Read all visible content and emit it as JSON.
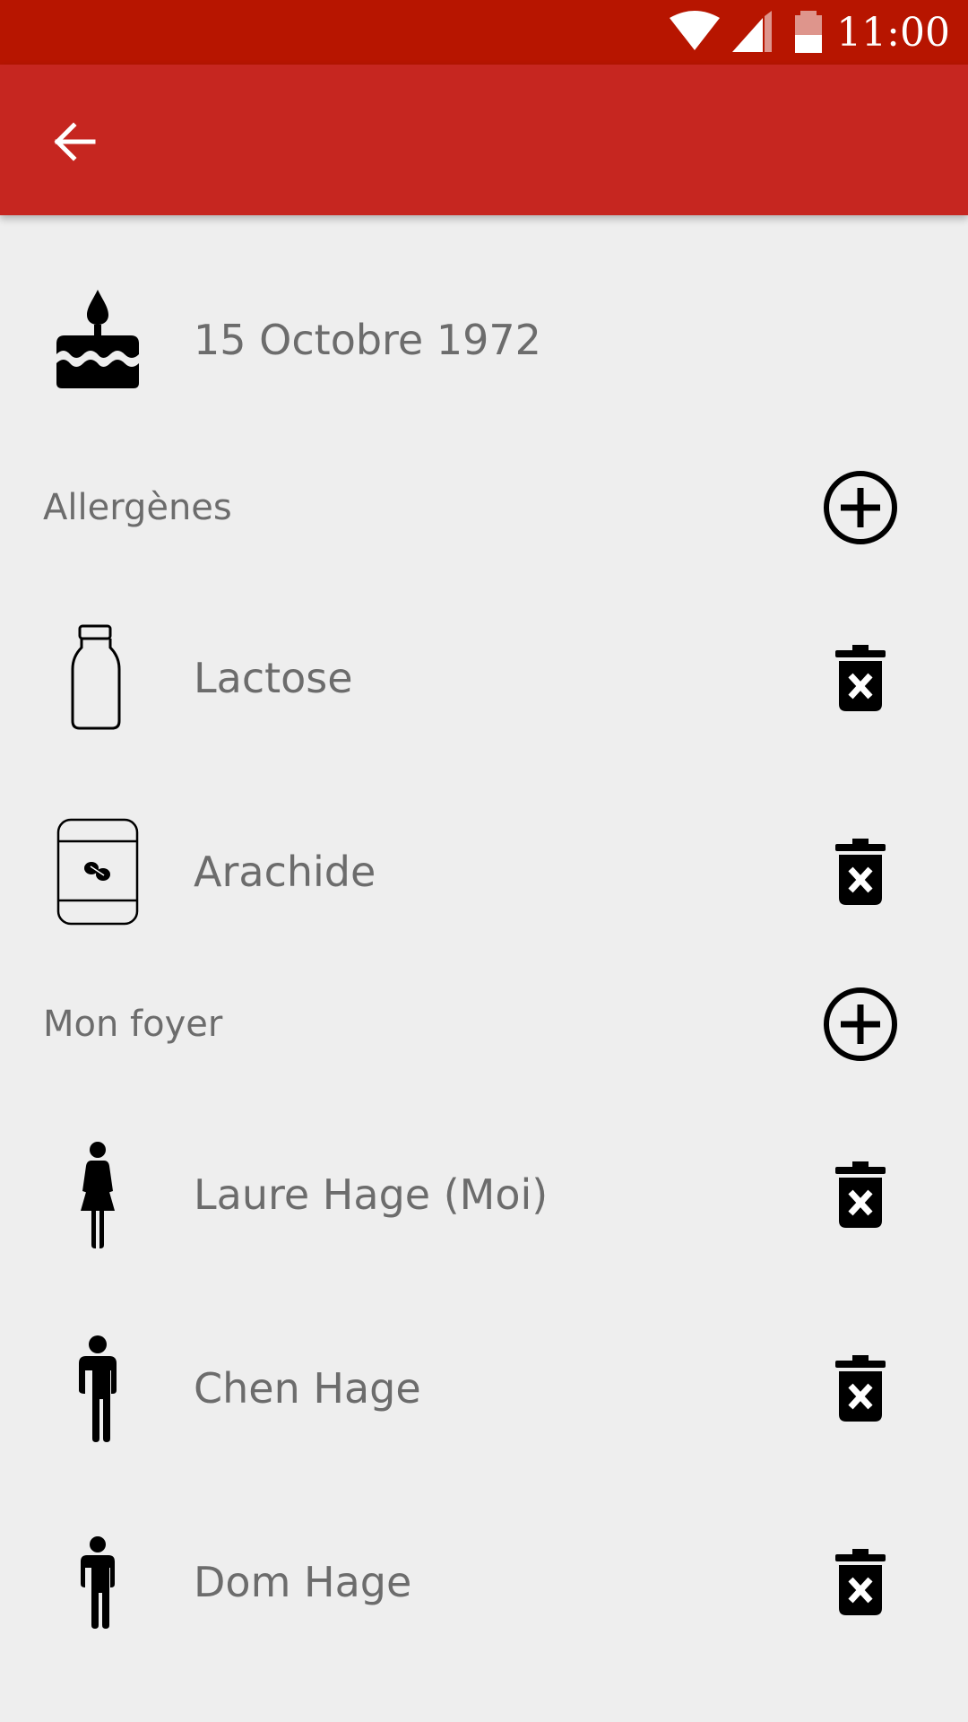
{
  "status_bar": {
    "time": "11:00",
    "icons": [
      "wifi-icon",
      "signal-icon",
      "battery-icon"
    ],
    "color": "#b71500"
  },
  "app_bar": {
    "color": "#c62620",
    "back_icon": "arrow-back-icon"
  },
  "birthday": {
    "icon": "cake-icon",
    "date": "15 Octobre 1972"
  },
  "allergens": {
    "title": "Allergènes",
    "add_icon": "add-circle-icon",
    "items": [
      {
        "icon": "milk-bottle-icon",
        "label": "Lactose",
        "delete_icon": "delete-icon"
      },
      {
        "icon": "peanut-jar-icon",
        "label": "Arachide",
        "delete_icon": "delete-icon"
      }
    ]
  },
  "household": {
    "title": "Mon foyer",
    "add_icon": "add-circle-icon",
    "members": [
      {
        "icon": "woman-icon",
        "label": "Laure Hage (Moi)",
        "delete_icon": "delete-icon"
      },
      {
        "icon": "man-icon",
        "label": "Chen Hage",
        "delete_icon": "delete-icon"
      },
      {
        "icon": "child-icon",
        "label": "Dom Hage",
        "delete_icon": "delete-icon"
      }
    ]
  }
}
